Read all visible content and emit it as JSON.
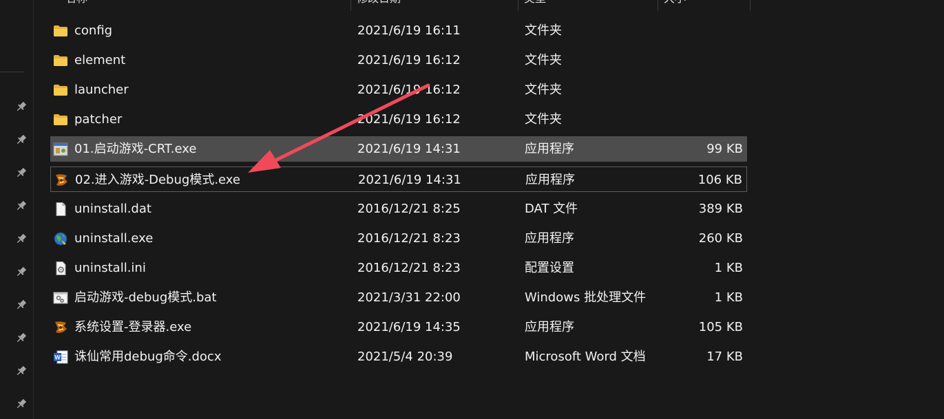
{
  "header": {
    "columns": [
      {
        "label": "名称"
      },
      {
        "label": "修改日期"
      },
      {
        "label": "类型"
      },
      {
        "label": "大小"
      }
    ]
  },
  "files": [
    {
      "name": "config",
      "date": "2021/6/19 16:11",
      "type": "文件夹",
      "size": "",
      "icon": "folder-icon"
    },
    {
      "name": "element",
      "date": "2021/6/19 16:12",
      "type": "文件夹",
      "size": "",
      "icon": "folder-icon"
    },
    {
      "name": "launcher",
      "date": "2021/6/19 16:12",
      "type": "文件夹",
      "size": "",
      "icon": "folder-icon"
    },
    {
      "name": "patcher",
      "date": "2021/6/19 16:12",
      "type": "文件夹",
      "size": "",
      "icon": "folder-icon"
    },
    {
      "name": "01.启动游戏-CRT.exe",
      "date": "2021/6/19 14:31",
      "type": "应用程序",
      "size": "99 KB",
      "icon": "app-window-icon"
    },
    {
      "name": "02.进入游戏-Debug模式.exe",
      "date": "2021/6/19 14:31",
      "type": "应用程序",
      "size": "106 KB",
      "icon": "game-logo-icon"
    },
    {
      "name": "uninstall.dat",
      "date": "2016/12/21 8:25",
      "type": "DAT 文件",
      "size": "389 KB",
      "icon": "blank-file-icon"
    },
    {
      "name": "uninstall.exe",
      "date": "2016/12/21 8:23",
      "type": "应用程序",
      "size": "260 KB",
      "icon": "globe-app-icon"
    },
    {
      "name": "uninstall.ini",
      "date": "2016/12/21 8:23",
      "type": "配置设置",
      "size": "1 KB",
      "icon": "config-file-icon"
    },
    {
      "name": "启动游戏-debug模式.bat",
      "date": "2021/3/31 22:00",
      "type": "Windows 批处理文件",
      "size": "1 KB",
      "icon": "batch-file-icon"
    },
    {
      "name": "系统设置-登录器.exe",
      "date": "2021/6/19 14:35",
      "type": "应用程序",
      "size": "105 KB",
      "icon": "game-logo-icon"
    },
    {
      "name": "诛仙常用debug命令.docx",
      "date": "2021/5/4 20:39",
      "type": "Microsoft Word 文档",
      "size": "17 KB",
      "icon": "word-doc-icon"
    }
  ],
  "selection": {
    "selected_index": 4,
    "focused_index": 5
  },
  "colors": {
    "background": "#191919",
    "selected": "#4d4d4d",
    "annotation_arrow": "#f04a5a",
    "folder": "#f3c54a"
  }
}
